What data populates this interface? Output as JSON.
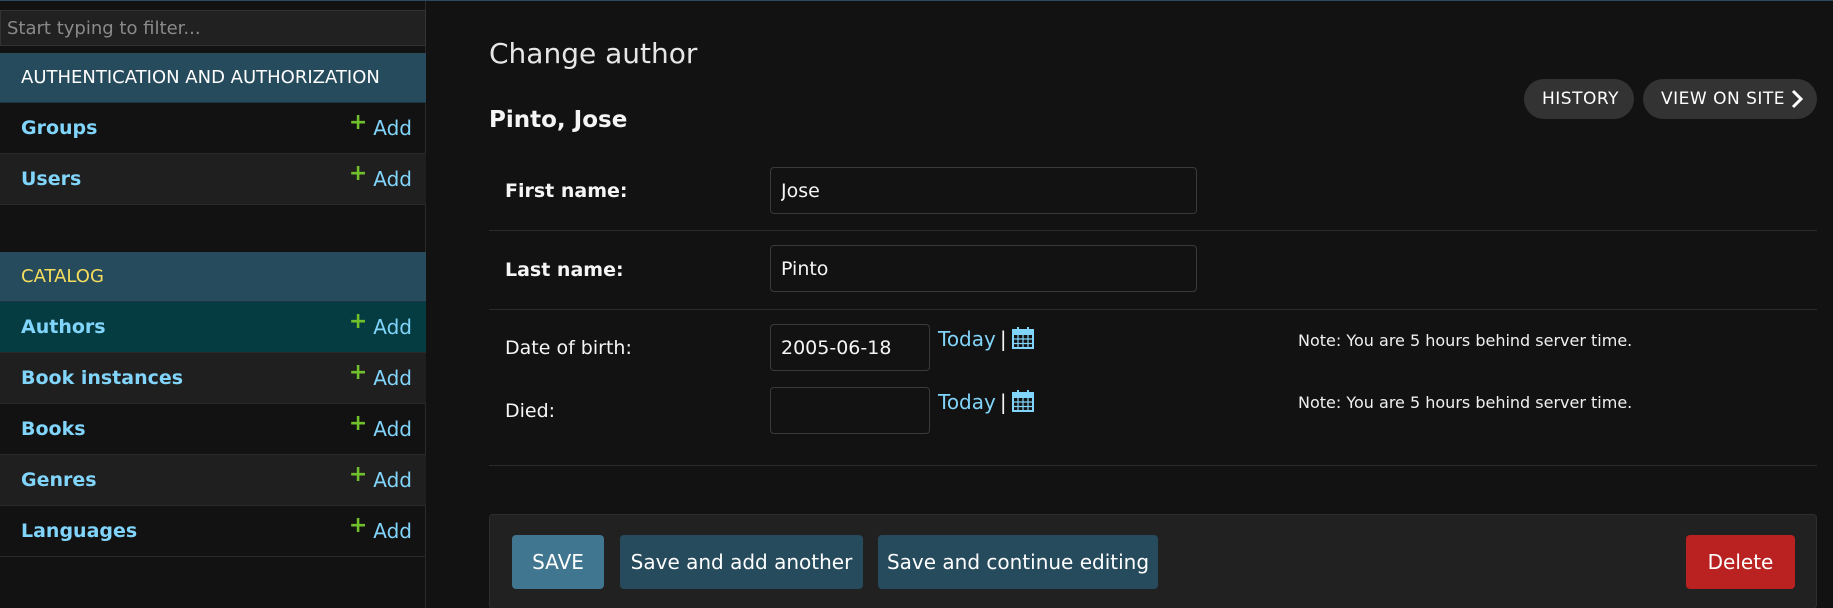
{
  "sidebar": {
    "filter_placeholder": "Start typing to filter...",
    "modules": [
      {
        "caption": "AUTHENTICATION AND AUTHORIZATION",
        "models": [
          {
            "name": "Groups",
            "add": "Add"
          },
          {
            "name": "Users",
            "add": "Add"
          }
        ]
      },
      {
        "caption": "CATALOG",
        "models": [
          {
            "name": "Authors",
            "add": "Add"
          },
          {
            "name": "Book instances",
            "add": "Add"
          },
          {
            "name": "Books",
            "add": "Add"
          },
          {
            "name": "Genres",
            "add": "Add"
          },
          {
            "name": "Languages",
            "add": "Add"
          }
        ]
      }
    ]
  },
  "header": {
    "title": "Change author",
    "object_name": "Pinto, Jose",
    "history_label": "HISTORY",
    "view_on_site_label": "VIEW ON SITE"
  },
  "form": {
    "first_name": {
      "label": "First name:",
      "value": "Jose"
    },
    "last_name": {
      "label": "Last name:",
      "value": "Pinto"
    },
    "date_of_birth": {
      "label": "Date of birth:",
      "value": "2005-06-18",
      "shortcut": "Today",
      "note": "Note: You are 5 hours behind server time."
    },
    "died": {
      "label": "Died:",
      "value": "",
      "shortcut": "Today",
      "note": "Note: You are 5 hours behind server time."
    }
  },
  "submit": {
    "save": "SAVE",
    "save_add": "Save and add another",
    "save_continue": "Save and continue editing",
    "delete": "Delete"
  },
  "colors": {
    "caption_bg": "#264b5d",
    "link": "#81d4fa",
    "add_plus": "#70bf2b",
    "delete": "#ba2121",
    "current_row": "#053c41"
  },
  "icons": {
    "add": "plus-icon",
    "calendar": "calendar-icon",
    "view_on_site": "chevron-right-icon"
  }
}
